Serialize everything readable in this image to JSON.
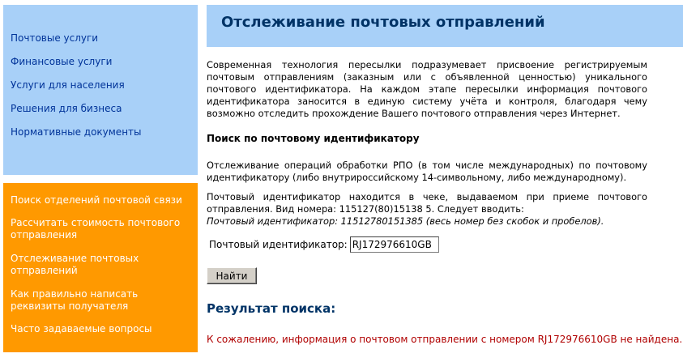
{
  "sidebar": {
    "blue_items": [
      {
        "label": "Почтовые услуги"
      },
      {
        "label": "Финансовые услуги"
      },
      {
        "label": "Услуги для населения"
      },
      {
        "label": "Решения для бизнеса"
      },
      {
        "label": "Нормативные документы"
      }
    ],
    "orange_items": [
      {
        "label": "Поиск отделений почтовой связи"
      },
      {
        "label": "Рассчитать стоимость почтового отправления"
      },
      {
        "label": "Отслеживание почтовых отправлений"
      },
      {
        "label": "Как правильно написать реквизиты получателя"
      },
      {
        "label": "Часто задаваемые вопросы"
      }
    ]
  },
  "header": {
    "title": "Отслеживание почтовых отправлений"
  },
  "main": {
    "intro": "Современная технология пересылки подразумевает присвоение регистрируемым почтовым отправлениям (заказным или с объявленной ценностью) уникального почтового идентификатора. На каждом этапе пересылки информация почтового идентификатора заносится в единую систему учёта и контроля, благодаря чему возможно отследить прохождение Вашего почтового отправления через Интернет.",
    "search_heading": "Поиск по почтовому идентификатору",
    "description": "Отслеживание операций обработки РПО (в том числе международных) по почтовому идентификатору (либо внутрироссийскому 14-символьному, либо международному).",
    "hint": "Почтовый идентификатор находится в чеке, выдаваемом при приеме почтового отправления. Вид номера: 115127(80)15138 5. Следует вводить:",
    "hint_example": "Почтовый идентификатор: 11512780151385 (весь номер без скобок и пробелов).",
    "form": {
      "label": "Почтовый идентификатор:",
      "value": "RJ172976610GB",
      "submit_label": "Найти"
    },
    "result_title": "Результат поиска:",
    "result_message": "К сожалению, информация о почтовом отправлении с номером RJ172976610GB не найдена."
  }
}
